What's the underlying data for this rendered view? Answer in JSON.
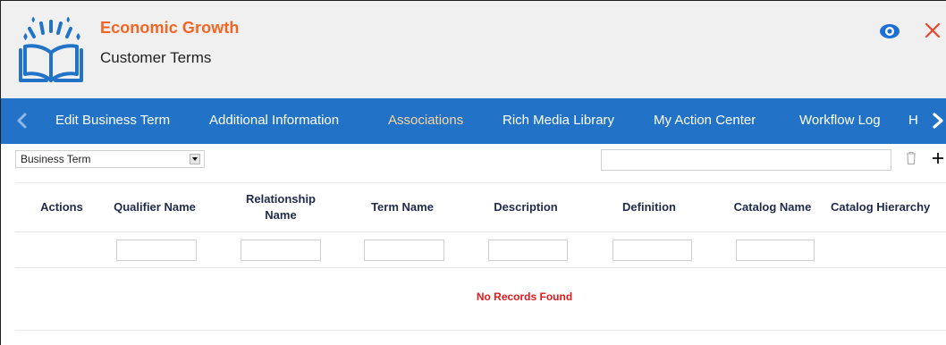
{
  "header": {
    "title": "Economic Growth",
    "subtitle": "Customer Terms"
  },
  "tabs": [
    {
      "label": "Edit Business Term",
      "active": false
    },
    {
      "label": "Additional Information",
      "active": false
    },
    {
      "label": "Associations",
      "active": true
    },
    {
      "label": "Rich Media Library",
      "active": false
    },
    {
      "label": "My Action Center",
      "active": false
    },
    {
      "label": "Workflow Log",
      "active": false
    },
    {
      "label": "H",
      "active": false
    }
  ],
  "toolbar": {
    "type_select_value": "Business Term",
    "search_value": ""
  },
  "table": {
    "columns": [
      "Actions",
      "Qualifier Name",
      "Relationship Name",
      "Term Name",
      "Description",
      "Definition",
      "Catalog Name",
      "Catalog Hierarchy"
    ],
    "empty_message": "No Records Found"
  },
  "colors": {
    "brand_orange": "#f26522",
    "tab_bar_blue": "#2273c8",
    "active_tab": "#f7d4a4",
    "eye_icon": "#1b6fd6",
    "close_icon": "#e8462d",
    "empty_message": "#e3191b",
    "column_header_text": "#1f2a4d"
  },
  "icons": {
    "logo": "open-book-sparkle-icon",
    "view": "eye-icon",
    "close": "close-icon",
    "tab_prev": "chevron-left-icon",
    "tab_next": "chevron-right-icon",
    "delete": "trash-icon",
    "add": "plus-icon",
    "dropdown": "caret-down-icon"
  }
}
